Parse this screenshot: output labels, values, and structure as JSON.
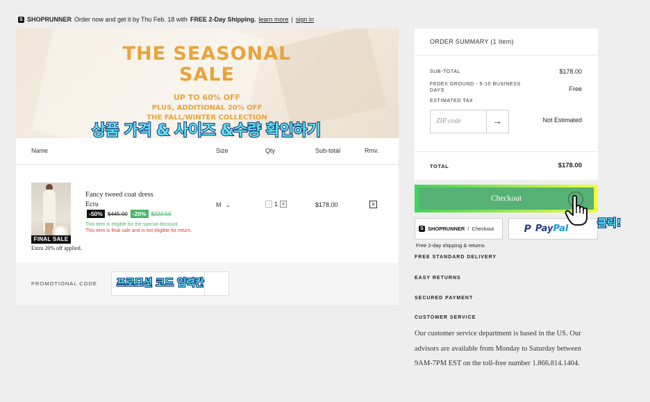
{
  "top_bar": {
    "brand": "SHOPRUNNER",
    "message_part1": "Order now and get it by Thu Feb. 18 with",
    "message_bold": "FREE 2-Day Shipping.",
    "learn_more": "learn more",
    "separator": "|",
    "sign_in": "sign in"
  },
  "banner": {
    "title_line1": "THE SEASONAL",
    "title_line2": "SALE",
    "sub_line1": "UP TO 60% OFF",
    "sub_line2": "PLUS, ADDITIONAL 20% OFF",
    "sub_line3": "THE FALL/WINTER COLLECTION",
    "accent_color": "#e8a43a"
  },
  "annotations": {
    "check_details": "상품 가격 & 사이즈 &수량 확인하기",
    "promo_field": "프로모션 코드 입력칸",
    "click": "클릭!"
  },
  "cart": {
    "columns": {
      "name": "Name",
      "size": "Size",
      "qty": "Qty",
      "subtotal": "Sub-total",
      "remove": "Rmv."
    },
    "item": {
      "name": "Fancy tweed coat dress",
      "color": "Ecru",
      "discount1": "-50%",
      "original_price": "$445.00",
      "discount2": "-20%",
      "sale_price": "$222.50",
      "note_eligible": "This item is eligible for the special discount",
      "note_final": "This item is final sale and is not eligible for return.",
      "final_sale_badge": "FINAL SALE",
      "extra_off": "Extra 20% off applied.",
      "size": "M",
      "size_chevron": "⌄",
      "qty": "1",
      "qty_minus": "−",
      "qty_plus": "+",
      "subtotal": "$178.00",
      "remove_symbol": "×"
    },
    "promo": {
      "label": "PROMOTIONAL CODE"
    }
  },
  "order_summary": {
    "title": "ORDER SUMMARY (1 Item)",
    "subtotal_label": "SUB-TOTAL",
    "subtotal_value": "$178.00",
    "shipping_label": "FEDEX GROUND - 5-10 BUSINESS DAYS",
    "shipping_value": "Free",
    "tax_label": "ESTIMATED TAX",
    "zip_placeholder": "ZIP code",
    "zip_arrow": "→",
    "tax_value": "Not Estimated",
    "total_label": "TOTAL",
    "total_value": "$178.00",
    "checkout_label": "Checkout",
    "checkout_color": "#55b174"
  },
  "alt_pay": {
    "shoprunner_brand": "SHOPRUNNER",
    "shoprunner_slash": "/",
    "shoprunner_action": "Checkout",
    "paypal_pay": "Pay",
    "paypal_pal": "Pal",
    "free_shipping_note": "Free 2-day shipping & returns"
  },
  "benefits": [
    "FREE STANDARD DELIVERY",
    "EASY RETURNS",
    "SECURED PAYMENT",
    "CUSTOMER SERVICE"
  ],
  "customer_service_text": "Our customer service department is based in the US. Our advisors are available from Monday to Saturday between 9AM-7PM EST on the toll-free number 1.866.814.1404."
}
